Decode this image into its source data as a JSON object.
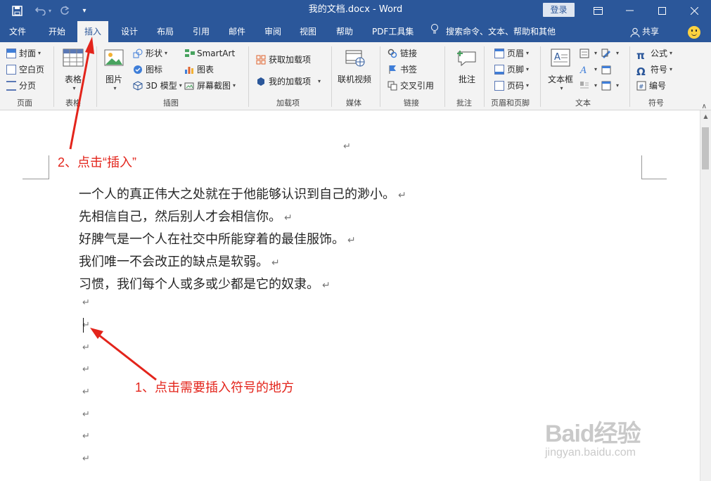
{
  "window": {
    "title": "我的文档.docx  -  Word",
    "login_label": "登录",
    "icons": [
      "save-icon",
      "undo-icon",
      "redo-icon",
      "customize-icon",
      "ribbon-display-icon",
      "minimize-icon",
      "maximize-icon",
      "close-icon"
    ]
  },
  "tabs": [
    {
      "label": "文件"
    },
    {
      "label": "开始"
    },
    {
      "label": "插入"
    },
    {
      "label": "设计"
    },
    {
      "label": "布局"
    },
    {
      "label": "引用"
    },
    {
      "label": "邮件"
    },
    {
      "label": "审阅"
    },
    {
      "label": "视图"
    },
    {
      "label": "帮助"
    },
    {
      "label": "PDF工具集"
    }
  ],
  "active_tab": "插入",
  "tell_me": "搜索命令、文本、帮助和其他",
  "share_label": "共享",
  "ribbon": {
    "pages": {
      "cover": "封面",
      "blank": "空白页",
      "break": "分页",
      "group": "页面"
    },
    "tables": {
      "table": "表格",
      "group": "表格"
    },
    "illustrations": {
      "picture": "图片",
      "shapes": "形状",
      "icons": "图标",
      "model3d": "3D 模型",
      "smartart": "SmartArt",
      "chart": "图表",
      "screenshot": "屏幕截图",
      "group": "插图"
    },
    "addins": {
      "get": "获取加载项",
      "my": "我的加载项",
      "group": "加载项"
    },
    "media": {
      "video": "联机视频",
      "group": "媒体"
    },
    "links": {
      "link": "链接",
      "bookmark": "书签",
      "crossref": "交叉引用",
      "group": "链接"
    },
    "comments": {
      "comment": "批注",
      "group": "批注"
    },
    "headerfooter": {
      "header": "页眉",
      "footer": "页脚",
      "pagenum": "页码",
      "group": "页眉和页脚"
    },
    "text": {
      "textbox": "文本框",
      "group": "文本"
    },
    "symbols": {
      "equation": "公式",
      "symbol": "符号",
      "number": "编号",
      "group": "符号"
    }
  },
  "document": {
    "paragraph_mark": "↵",
    "lines": [
      "一个人的真正伟大之处就在于他能够认识到自己的渺小。",
      "先相信自己，然后别人才会相信你。",
      "好脾气是一个人在社交中所能穿着的最佳服饰。",
      "我们唯一不会改正的缺点是软弱。",
      "习惯，我们每个人或多或少都是它的奴隶。"
    ]
  },
  "annotations": {
    "step2": "2、点击“插入”",
    "step1": "1、点击需要插入符号的地方"
  },
  "watermark": {
    "brand": "Baid经验",
    "url": "jingyan.baidu.com"
  },
  "colors": {
    "titlebar": "#2b579a",
    "ribbon": "#f3f3f3",
    "annotation": "#e3241b"
  }
}
